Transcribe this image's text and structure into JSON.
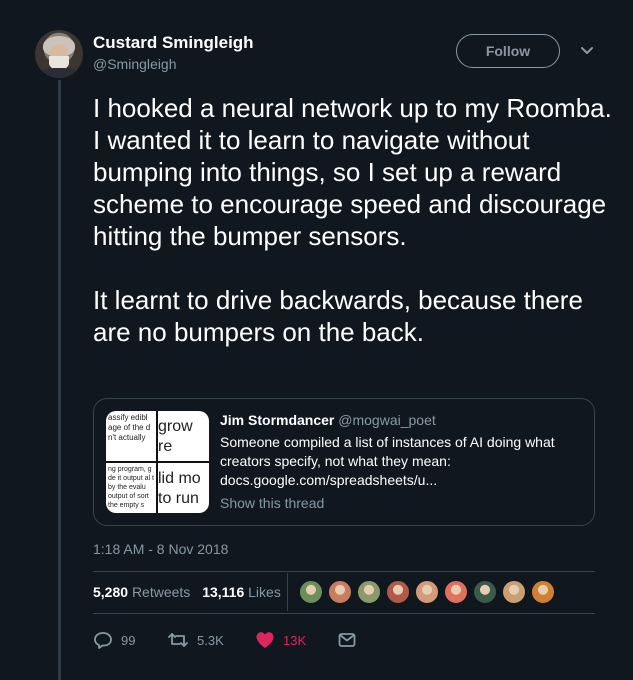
{
  "author": {
    "name": "Custard Smingleigh",
    "handle": "@Smingleigh"
  },
  "follow_label": "Follow",
  "tweet": {
    "text": "I hooked a neural network up to my Roomba. I wanted it to learn to navigate without bumping into things, so I set up a reward scheme to encourage speed and discourage hitting the bumper sensors.\n\nIt learnt to drive backwards, because there are no bumpers on the back."
  },
  "quoted": {
    "name": "Jim Stormdancer",
    "handle": "@mogwai_poet",
    "text": "Someone compiled a list of instances of AI doing what creators specify, not what they mean:",
    "link": "docs.google.com/spreadsheets/u...",
    "show_thread": "Show this thread",
    "thumbnail": {
      "q1": "assify edibl age of the d n't actually",
      "q2": "grow re",
      "q3": "ng program, g de it output al t by the evalu output of sort the empty s",
      "q4": "lid mo to run"
    }
  },
  "timestamp": "1:18 AM - 8 Nov 2018",
  "stats": {
    "retweets_count": "5,280",
    "retweets_label": "Retweets",
    "likes_count": "13,116",
    "likes_label": "Likes"
  },
  "likers_colors": [
    "#6b8f5a",
    "#c77d5e",
    "#8a9a6a",
    "#b05a4a",
    "#d49a7a",
    "#e07060",
    "#3a5a4a",
    "#c9a070",
    "#d08030"
  ],
  "actions": {
    "replies": "99",
    "retweets": "5.3K",
    "likes": "13K"
  },
  "colors": {
    "background": "#10171e",
    "secondary_text": "#8899a6",
    "border": "#38444d",
    "like_red": "#e0245e"
  },
  "icons": [
    "chevron-down-icon",
    "reply-icon",
    "retweet-icon",
    "heart-icon",
    "message-icon"
  ]
}
